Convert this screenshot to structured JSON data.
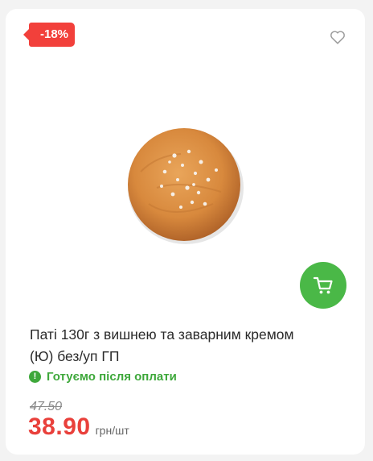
{
  "badge": {
    "discount": "-18%"
  },
  "icons": {
    "favorite": "heart-icon",
    "cart": "cart-icon",
    "status": "exclamation-circle-icon"
  },
  "product": {
    "title_line1": "Паті 130г з вишнею та заварним кремом",
    "title_line2": "(Ю) без/уп ГП",
    "status": "Готуємо після оплати",
    "old_price": "47.50",
    "price": "38.90",
    "unit": "грн/шт"
  },
  "colors": {
    "discount": "#f2403b",
    "cart": "#4ab847",
    "status": "#3ea83b",
    "price": "#e9403b"
  }
}
